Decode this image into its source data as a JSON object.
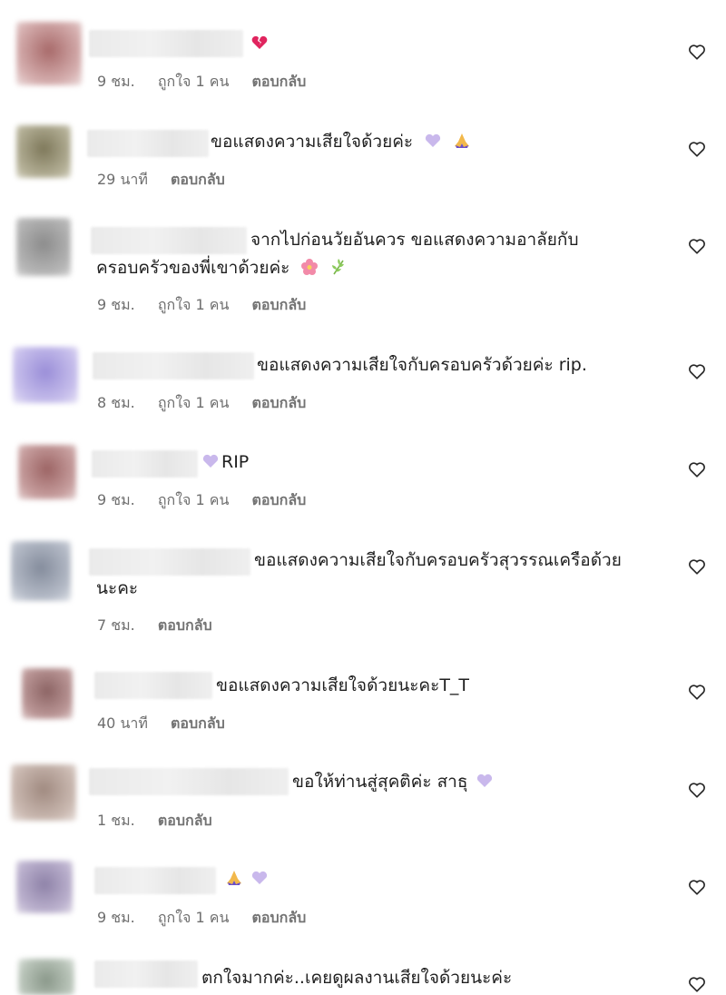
{
  "comments": [
    {
      "text": "",
      "emoji": [
        "broken-heart-icon"
      ],
      "time": "9 ชม.",
      "likes": "ถูกใจ 1 คน",
      "reply": "ตอบกลับ",
      "avatar_color": "#b98a8a"
    },
    {
      "text": "ขอแสดงความเสียใจด้วยค่ะ",
      "emoji": [
        "purple-heart-icon",
        "folded-hands-icon"
      ],
      "time": "29 นาที",
      "likes": "",
      "reply": "ตอบกลับ",
      "avatar_color": "#8f8a6b"
    },
    {
      "text": "จากไปก่อนวัยอันควร ขอแสดงความอาลัยกับ",
      "line2": "ครอบครัวของพี่เขาด้วยค่ะ",
      "emoji2": [
        "flower-icon",
        "herb-icon"
      ],
      "time": "9 ชม.",
      "likes": "ถูกใจ 1 คน",
      "reply": "ตอบกลับ",
      "avatar_color": "#9a9a9a"
    },
    {
      "text": "ขอแสดงความเสียใจกับครอบครัวด้วยค่ะ rip.",
      "emoji": [],
      "time": "8 ชม.",
      "likes": "ถูกใจ 1 คน",
      "reply": "ตอบกลับ",
      "avatar_color": "#b0a6d8"
    },
    {
      "text": "RIP",
      "emoji_before": [
        "purple-heart-icon"
      ],
      "time": "9 ชม.",
      "likes": "ถูกใจ 1 คน",
      "reply": "ตอบกลับ",
      "avatar_color": "#b07a7a"
    },
    {
      "text": "ขอแสดงความเสียใจกับครอบครัวสุวรรณเครือด้วย",
      "line2": "นะคะ",
      "time": "7 ชม.",
      "likes": "",
      "reply": "ตอบกลับ",
      "avatar_color": "#9aa0ac"
    },
    {
      "text": "ขอแสดงความเสียใจด้วยนะคะT_T",
      "time": "40 นาที",
      "likes": "",
      "reply": "ตอบกลับ",
      "avatar_color": "#a07a7a"
    },
    {
      "text": "ขอให้ท่านสู่สุคติค่ะ สาธุ",
      "emoji": [
        "purple-heart-icon"
      ],
      "time": "1 ชม.",
      "likes": "",
      "reply": "ตอบกลับ",
      "avatar_color": "#b8a098"
    },
    {
      "text": "",
      "emoji": [
        "folded-hands-icon",
        "purple-heart-icon"
      ],
      "time": "9 ชม.",
      "likes": "ถูกใจ 1 คน",
      "reply": "ตอบกลับ",
      "avatar_color": "#a89ab8"
    },
    {
      "text": "ตกใจมากค่ะ..เคยดูผลงานเสียใจด้วยนะค่ะ",
      "avatar_color": "#9aa89a"
    }
  ]
}
